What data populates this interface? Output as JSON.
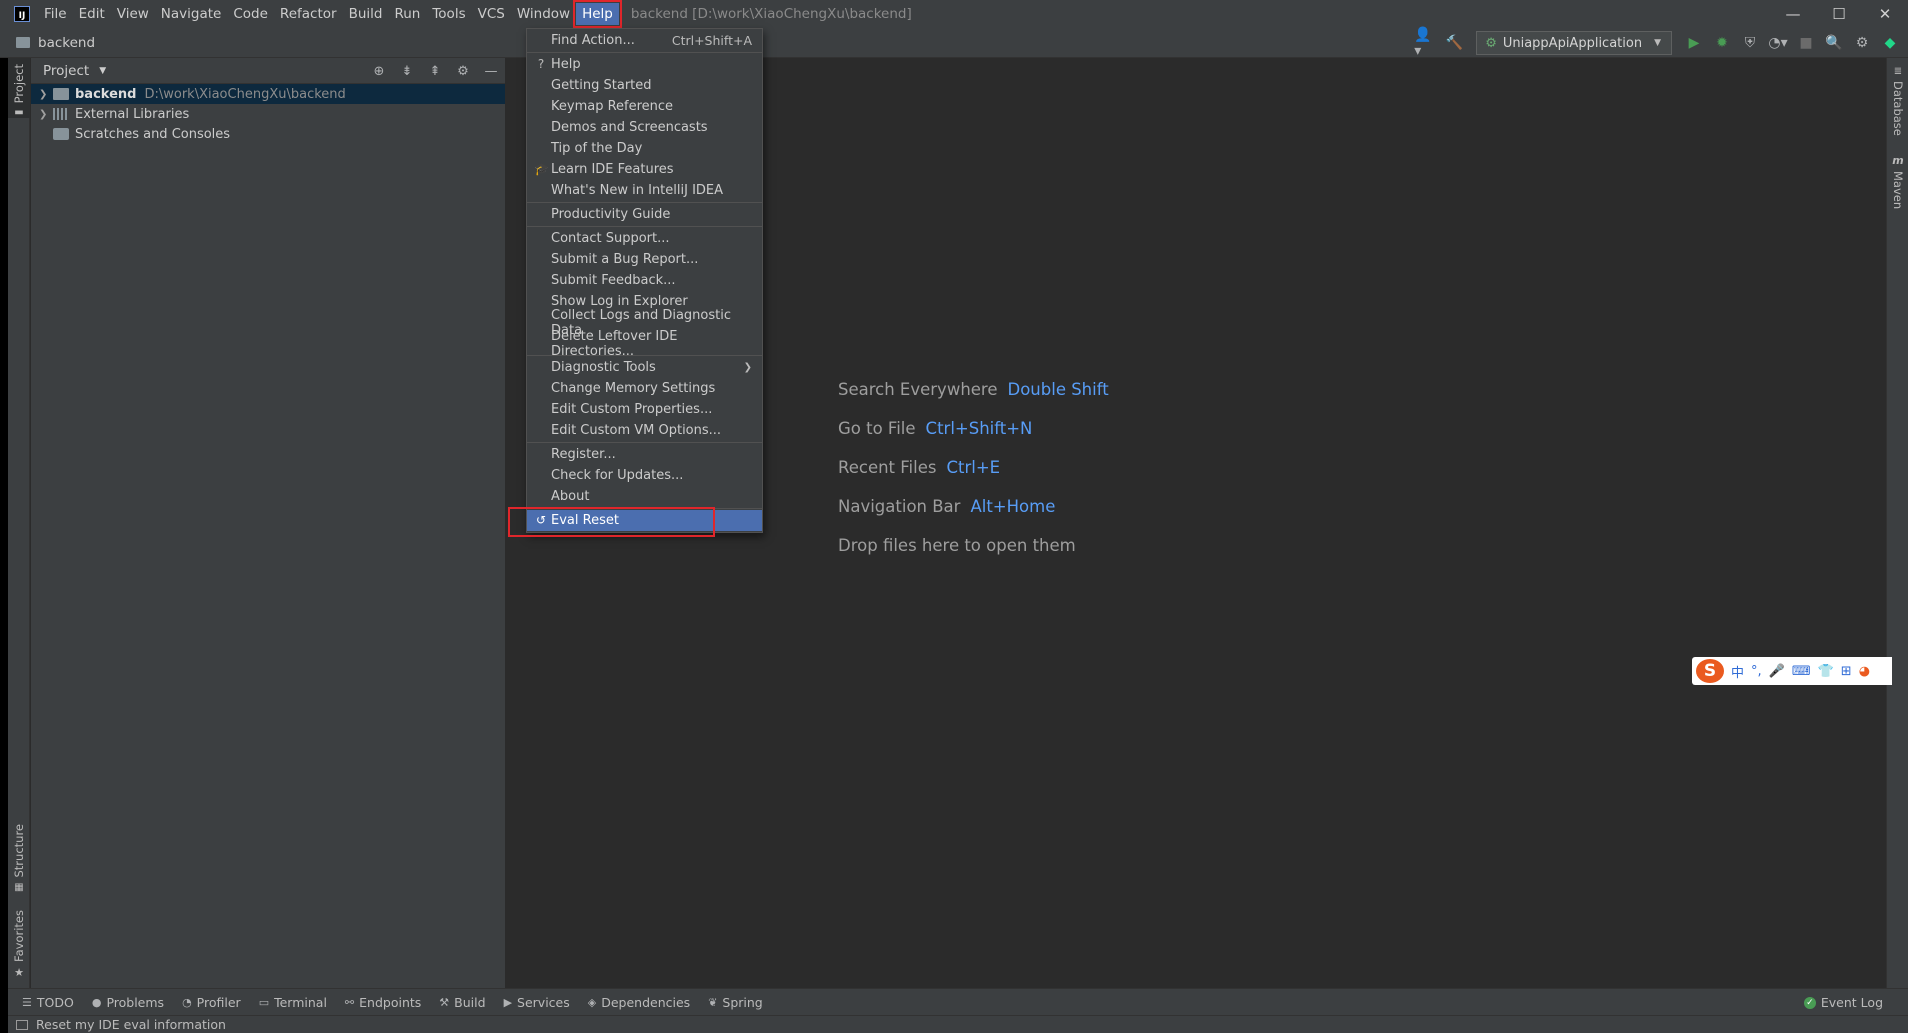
{
  "titlebar": {
    "menus": [
      "File",
      "Edit",
      "View",
      "Navigate",
      "Code",
      "Refactor",
      "Build",
      "Run",
      "Tools",
      "VCS",
      "Window",
      "Help"
    ],
    "active_menu": "Help",
    "window_title": "backend [D:\\work\\XiaoChengXu\\backend]"
  },
  "navbar": {
    "breadcrumb": "backend",
    "run_config": "UniappApiApplication"
  },
  "left_stripe": {
    "project": "Project",
    "structure": "Structure",
    "favorites": "Favorites"
  },
  "right_stripe": {
    "database": "Database",
    "maven": "Maven"
  },
  "project_panel": {
    "title": "Project",
    "tree": [
      {
        "label": "backend",
        "path": "D:\\work\\XiaoChengXu\\backend"
      },
      {
        "label": "External Libraries"
      },
      {
        "label": "Scratches and Consoles"
      }
    ]
  },
  "help_menu": {
    "find_action": {
      "label": "Find Action...",
      "shortcut": "Ctrl+Shift+A"
    },
    "group1": [
      "Help",
      "Getting Started",
      "Keymap Reference",
      "Demos and Screencasts",
      "Tip of the Day",
      "Learn IDE Features",
      "What's New in IntelliJ IDEA"
    ],
    "group2": [
      "Productivity Guide"
    ],
    "group3": [
      "Contact Support...",
      "Submit a Bug Report...",
      "Submit Feedback...",
      "Show Log in Explorer",
      "Collect Logs and Diagnostic Data",
      "Delete Leftover IDE Directories..."
    ],
    "group4": [
      "Diagnostic Tools",
      "Change Memory Settings",
      "Edit Custom Properties...",
      "Edit Custom VM Options..."
    ],
    "group5": [
      "Register...",
      "Check for Updates...",
      "About"
    ],
    "eval_reset": "Eval Reset"
  },
  "editor_hints": [
    {
      "label": "Search Everywhere",
      "key": "Double Shift"
    },
    {
      "label": "Go to File",
      "key": "Ctrl+Shift+N"
    },
    {
      "label": "Recent Files",
      "key": "Ctrl+E"
    },
    {
      "label": "Navigation Bar",
      "key": "Alt+Home"
    },
    {
      "label": "Drop files here to open them",
      "key": ""
    }
  ],
  "bottom_tabs": [
    "TODO",
    "Problems",
    "Profiler",
    "Terminal",
    "Endpoints",
    "Build",
    "Services",
    "Dependencies",
    "Spring"
  ],
  "event_log": "Event Log",
  "status": "Reset my IDE eval information",
  "ime": {
    "chinese": "中"
  },
  "colors": {
    "accent": "#4b6eaf",
    "highlight_box": "#e0262b",
    "hint_key": "#589df6"
  }
}
